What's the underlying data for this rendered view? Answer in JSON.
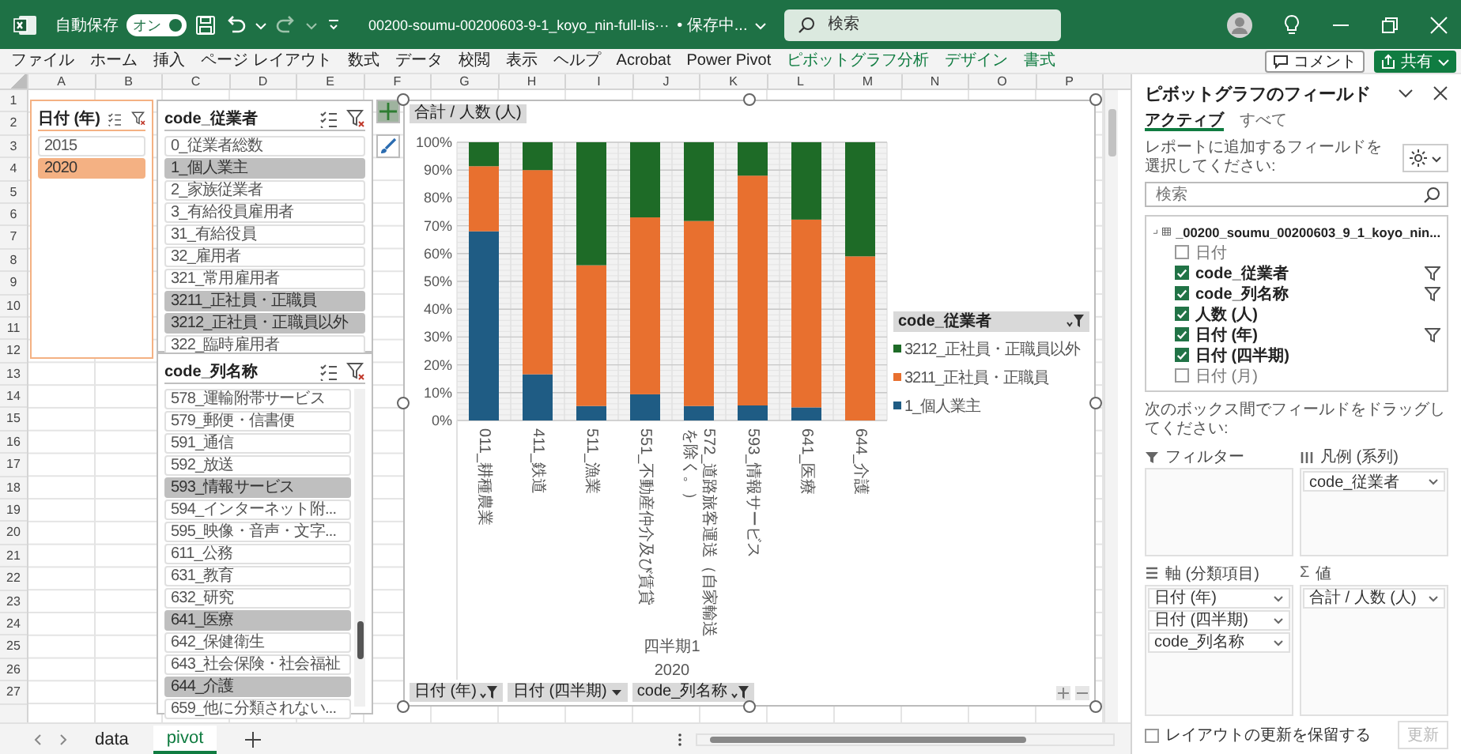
{
  "title_bar": {
    "autosave_label": "自動保存",
    "autosave_toggle": {
      "label": "オン",
      "on": true
    },
    "filename": "00200-soumu-00200603-9-1_koyo_nin-full-lis···",
    "save_status": "• 保存中...",
    "search": {
      "placeholder": "検索"
    }
  },
  "ribbon": {
    "tabs": [
      {
        "label": "ファイル",
        "kind": "standard"
      },
      {
        "label": "ホーム",
        "kind": "standard"
      },
      {
        "label": "挿入",
        "kind": "standard"
      },
      {
        "label": "ページ レイアウト",
        "kind": "standard"
      },
      {
        "label": "数式",
        "kind": "standard"
      },
      {
        "label": "データ",
        "kind": "standard"
      },
      {
        "label": "校閲",
        "kind": "standard"
      },
      {
        "label": "表示",
        "kind": "standard"
      },
      {
        "label": "ヘルプ",
        "kind": "standard"
      },
      {
        "label": "Acrobat",
        "kind": "standard"
      },
      {
        "label": "Power Pivot",
        "kind": "standard"
      },
      {
        "label": "ピボットグラフ分析",
        "kind": "contextual"
      },
      {
        "label": "デザイン",
        "kind": "contextual"
      },
      {
        "label": "書式",
        "kind": "contextual"
      }
    ],
    "buttons": [
      {
        "label": "コメント",
        "kind": "comment"
      },
      {
        "label": "共有",
        "kind": "share"
      }
    ]
  },
  "sheet": {
    "columns": [
      "A",
      "B",
      "C",
      "D",
      "E",
      "F",
      "G",
      "H",
      "I",
      "J",
      "K",
      "L",
      "M",
      "N",
      "O",
      "P"
    ],
    "rows": [
      "1",
      "2",
      "3",
      "4",
      "5",
      "6",
      "7",
      "8",
      "9",
      "10",
      "11",
      "12",
      "13",
      "14",
      "15",
      "16",
      "17",
      "18",
      "19",
      "20",
      "21",
      "22",
      "23",
      "24",
      "25",
      "26",
      "27"
    ]
  },
  "slicers": [
    {
      "title": "日付 (年)",
      "color": "#f4b183",
      "items": [
        {
          "label": "2015",
          "selected": false
        },
        {
          "label": "2020",
          "selected": true
        }
      ]
    },
    {
      "title": "code_従業者",
      "color": "#bfbfbf",
      "items": [
        {
          "label": "0_従業者総数",
          "selected": false
        },
        {
          "label": "1_個人業主",
          "selected": true
        },
        {
          "label": "2_家族従業者",
          "selected": false
        },
        {
          "label": "3_有給役員雇用者",
          "selected": false
        },
        {
          "label": "31_有給役員",
          "selected": false
        },
        {
          "label": "32_雇用者",
          "selected": false
        },
        {
          "label": "321_常用雇用者",
          "selected": false
        },
        {
          "label": "3211_正社員・正職員",
          "selected": true
        },
        {
          "label": "3212_正社員・正職員以外",
          "selected": true
        },
        {
          "label": "322_臨時雇用者",
          "selected": false
        }
      ]
    },
    {
      "title": "code_列名称",
      "color": "#bfbfbf",
      "scrollable": true,
      "items": [
        {
          "label": "578_運輸附帯サービス",
          "selected": false
        },
        {
          "label": "579_郵便・信書便",
          "selected": false
        },
        {
          "label": "591_通信",
          "selected": false
        },
        {
          "label": "592_放送",
          "selected": false
        },
        {
          "label": "593_情報サービス",
          "selected": true
        },
        {
          "label": "594_インターネット附...",
          "selected": false
        },
        {
          "label": "595_映像・音声・文字...",
          "selected": false
        },
        {
          "label": "611_公務",
          "selected": false
        },
        {
          "label": "631_教育",
          "selected": false
        },
        {
          "label": "632_研究",
          "selected": false
        },
        {
          "label": "641_医療",
          "selected": true
        },
        {
          "label": "642_保健衛生",
          "selected": false
        },
        {
          "label": "643_社会保険・社会福祉",
          "selected": false
        },
        {
          "label": "644_介護",
          "selected": true
        },
        {
          "label": "659_他に分類されない...",
          "selected": false
        }
      ]
    }
  ],
  "pivot_chart": {
    "value_field_button": "合計 / 人数 (人)",
    "chart_data": {
      "type": "bar",
      "orientation": "vertical",
      "stacked": true,
      "categories": [
        "011_耕種農業",
        "411_鉄道",
        "511_漁業",
        "551_不動産仲介及び賃貸",
        "572_道路旅客運送（自家輸送を除く。）",
        "593_情報サービス",
        "641_医療",
        "644_介護"
      ],
      "series": [
        {
          "name": "1_個人業主",
          "color": "#1f5c84",
          "values": [
            68,
            16.6,
            5.2,
            9.4,
            5.2,
            5.4,
            4.7,
            0
          ]
        },
        {
          "name": "3211_正社員・正職員",
          "color": "#e8702f",
          "values": [
            23.4,
            73.4,
            50.6,
            63.6,
            66.5,
            82.6,
            67.5,
            59
          ]
        },
        {
          "name": "3212_正社員・正職員以外",
          "color": "#1e6b27",
          "values": [
            8.6,
            10,
            44.2,
            27,
            28.3,
            12,
            27.8,
            41
          ]
        }
      ],
      "grid": true,
      "ylim": [
        0,
        100
      ],
      "yticks": [
        {
          "value": 0,
          "label": "0%"
        },
        {
          "value": 10,
          "label": "10%"
        },
        {
          "value": 20,
          "label": "20%"
        },
        {
          "value": 30,
          "label": "30%"
        },
        {
          "value": 40,
          "label": "40%"
        },
        {
          "value": 50,
          "label": "50%"
        },
        {
          "value": 60,
          "label": "60%"
        },
        {
          "value": 70,
          "label": "70%"
        },
        {
          "value": 80,
          "label": "80%"
        },
        {
          "value": 90,
          "label": "90%"
        },
        {
          "value": 100,
          "label": "100%"
        }
      ]
    },
    "axis_group_labels": [
      "四半期1",
      "2020"
    ],
    "legend_title": "code_従業者",
    "axis_field_buttons": [
      {
        "label": "日付 (年)",
        "filtered": true
      },
      {
        "label": "日付 (四半期)",
        "filtered": false
      },
      {
        "label": "code_列名称",
        "filtered": true
      }
    ]
  },
  "field_pane": {
    "title": "ピボットグラフのフィールド",
    "tabs": [
      {
        "label": "アクティブ",
        "selected": true
      },
      {
        "label": "すべて",
        "selected": false
      }
    ],
    "instruction": "レポートに追加するフィールドを選択してください:",
    "search": {
      "placeholder": "検索"
    },
    "table_name": "_00200_soumu_00200603_9_1_koyo_nin...",
    "fields": [
      {
        "label": "日付",
        "checked": false,
        "filtered": false
      },
      {
        "label": "code_従業者",
        "checked": true,
        "filtered": true
      },
      {
        "label": "code_列名称",
        "checked": true,
        "filtered": true
      },
      {
        "label": "人数 (人)",
        "checked": true,
        "filtered": false
      },
      {
        "label": "日付 (年)",
        "checked": true,
        "filtered": true
      },
      {
        "label": "日付 (四半期)",
        "checked": true,
        "filtered": false
      },
      {
        "label": "日付 (月)",
        "checked": false,
        "filtered": false
      }
    ],
    "drag_instruction": "次のボックス間でフィールドをドラッグしてください:",
    "areas": [
      {
        "kind": "filter",
        "label": "フィルター"
      },
      {
        "kind": "legend",
        "label": "凡例 (系列)",
        "items": [
          "code_従業者"
        ]
      },
      {
        "kind": "axis",
        "label": "軸 (分類項目)",
        "items": [
          "日付 (年)",
          "日付 (四半期)",
          "code_列名称"
        ]
      },
      {
        "kind": "values",
        "symbol": "Σ",
        "label": "値",
        "items": [
          "合計 / 人数 (人)"
        ]
      }
    ],
    "defer_update": {
      "label": "レイアウトの更新を保留する",
      "checked": false
    },
    "update_button": {
      "label": "更新",
      "disabled": true
    }
  },
  "sheet_tabs": [
    {
      "label": "data",
      "selected": false
    },
    {
      "label": "pivot",
      "selected": true
    }
  ]
}
